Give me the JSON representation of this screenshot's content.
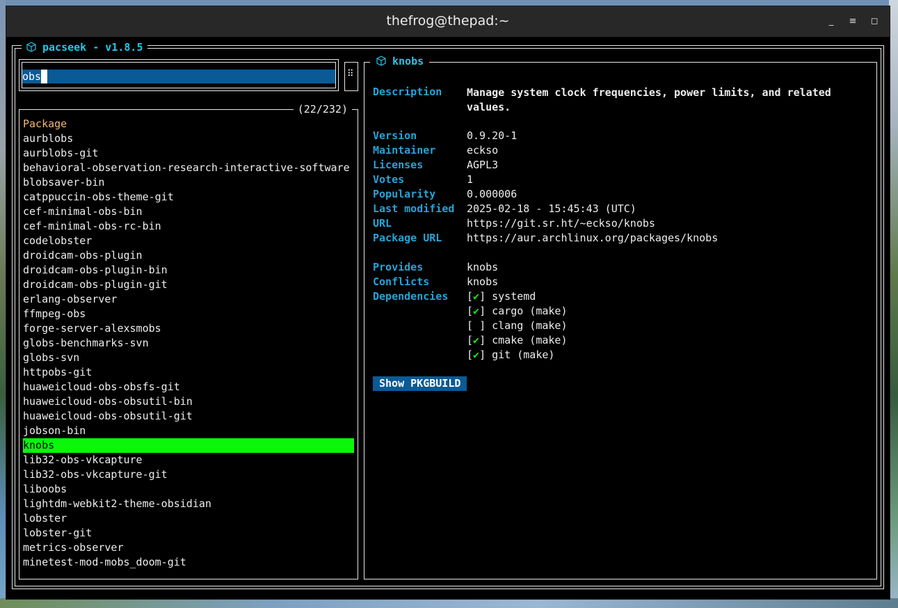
{
  "window": {
    "title": "thefrog@thepad:~",
    "buttons": {
      "minimize": "_",
      "menu": "≡",
      "maximize": "◻"
    }
  },
  "app": {
    "title": "pacseek - v1.8.5",
    "icon": "package-icon"
  },
  "search": {
    "value": "obs",
    "menu_glyph": "⠿"
  },
  "list": {
    "count": "(22/232)",
    "header": "Package",
    "items": [
      "aurblobs",
      "aurblobs-git",
      "behavioral-observation-research-interactive-software",
      "blobsaver-bin",
      "catppuccin-obs-theme-git",
      "cef-minimal-obs-bin",
      "cef-minimal-obs-rc-bin",
      "codelobster",
      "droidcam-obs-plugin",
      "droidcam-obs-plugin-bin",
      "droidcam-obs-plugin-git",
      "erlang-observer",
      "ffmpeg-obs",
      "forge-server-alexsmobs",
      "globs-benchmarks-svn",
      "globs-svn",
      "httpobs-git",
      "huaweicloud-obs-obsfs-git",
      "huaweicloud-obs-obsutil-bin",
      "huaweicloud-obs-obsutil-git",
      "jobson-bin",
      "knobs",
      "lib32-obs-vkcapture",
      "lib32-obs-vkcapture-git",
      "liboobs",
      "lightdm-webkit2-theme-obsidian",
      "lobster",
      "lobster-git",
      "metrics-observer",
      "minetest-mod-mobs_doom-git"
    ],
    "selected": "knobs"
  },
  "details": {
    "title": "knobs",
    "labels": {
      "description": "Description",
      "version": "Version",
      "maintainer": "Maintainer",
      "licenses": "Licenses",
      "votes": "Votes",
      "popularity": "Popularity",
      "last_modified": "Last modified",
      "url": "URL",
      "package_url": "Package URL",
      "provides": "Provides",
      "conflicts": "Conflicts",
      "dependencies": "Dependencies"
    },
    "values": {
      "description": "Manage system clock frequencies, power limits, and related values.",
      "version": "0.9.20-1",
      "maintainer": "eckso",
      "licenses": "AGPL3",
      "votes": "1",
      "popularity": "0.000006",
      "last_modified": "2025-02-18 - 15:45:43 (UTC)",
      "url": "https://git.sr.ht/~eckso/knobs",
      "package_url": "https://aur.archlinux.org/packages/knobs",
      "provides": "knobs",
      "conflicts": "knobs"
    },
    "dependencies": [
      {
        "name": "systemd",
        "installed": "✔"
      },
      {
        "name": "cargo (make)",
        "installed": "✔"
      },
      {
        "name": "clang (make)",
        "installed": " "
      },
      {
        "name": "cmake (make)",
        "installed": "✔"
      },
      {
        "name": "git (make)",
        "installed": "✔"
      }
    ],
    "pkgbuild_button": "Show PKGBUILD"
  },
  "colors": {
    "accent_title": "#24c8e8",
    "label_blue": "#27a3d8",
    "selection_green": "#0af70a",
    "input_bg": "#0a5a96",
    "header_orange": "#f2b87a"
  }
}
